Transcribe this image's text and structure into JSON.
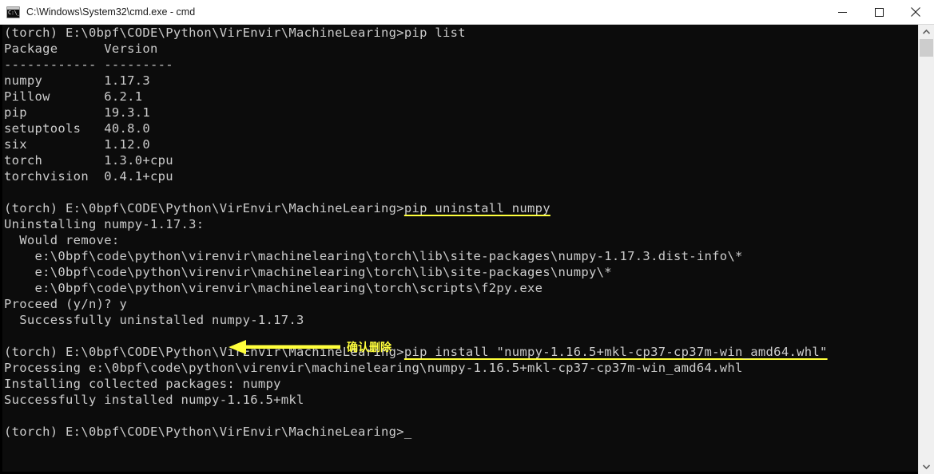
{
  "window": {
    "title": "C:\\Windows\\System32\\cmd.exe - cmd",
    "icon_label": "C:\\_",
    "minimize_label": "Minimize",
    "maximize_label": "Maximize",
    "close_label": "Close",
    "background_color": "#0c0c0c",
    "text_color": "#cccccc",
    "titlebar_color": "#ffffff"
  },
  "scrollbar": {
    "up_label": "Scroll up",
    "down_label": "Scroll down",
    "thumb_label": "Scroll thumb"
  },
  "annotation": {
    "label": "确认删除",
    "color": "#ffff3c",
    "arrow_direction": "left"
  },
  "console": {
    "prompt": "(torch) E:\\0bpf\\CODE\\Python\\VirEnvir\\MachineLearing>",
    "cursor": "_",
    "lines": [
      {
        "id": "l01",
        "text": "(torch) E:\\0bpf\\CODE\\Python\\VirEnvir\\MachineLearing>pip list"
      },
      {
        "id": "l02",
        "text": "Package      Version"
      },
      {
        "id": "l03",
        "text": "------------ ---------"
      },
      {
        "id": "l04",
        "text": "numpy        1.17.3"
      },
      {
        "id": "l05",
        "text": "Pillow       6.2.1"
      },
      {
        "id": "l06",
        "text": "pip          19.3.1"
      },
      {
        "id": "l07",
        "text": "setuptools   40.8.0"
      },
      {
        "id": "l08",
        "text": "six          1.12.0"
      },
      {
        "id": "l09",
        "text": "torch        1.3.0+cpu"
      },
      {
        "id": "l10",
        "text": "torchvision  0.4.1+cpu"
      },
      {
        "id": "l11",
        "text": ""
      },
      {
        "id": "l12",
        "text": "(torch) E:\\0bpf\\CODE\\Python\\VirEnvir\\MachineLearing>",
        "underlined": "pip uninstall numpy"
      },
      {
        "id": "l13",
        "text": "Uninstalling numpy-1.17.3:"
      },
      {
        "id": "l14",
        "text": "  Would remove:"
      },
      {
        "id": "l15",
        "text": "    e:\\0bpf\\code\\python\\virenvir\\machinelearing\\torch\\lib\\site-packages\\numpy-1.17.3.dist-info\\*"
      },
      {
        "id": "l16",
        "text": "    e:\\0bpf\\code\\python\\virenvir\\machinelearing\\torch\\lib\\site-packages\\numpy\\*"
      },
      {
        "id": "l17",
        "text": "    e:\\0bpf\\code\\python\\virenvir\\machinelearing\\torch\\scripts\\f2py.exe"
      },
      {
        "id": "l18",
        "text": "Proceed (y/n)? y"
      },
      {
        "id": "l19",
        "text": "  Successfully uninstalled numpy-1.17.3"
      },
      {
        "id": "l20",
        "text": ""
      },
      {
        "id": "l21",
        "text": "(torch) E:\\0bpf\\CODE\\Python\\VirEnvir\\MachineLearing>",
        "underlined": "pip install \"numpy-1.16.5+mkl-cp37-cp37m-win_amd64.whl\""
      },
      {
        "id": "l22",
        "text": "Processing e:\\0bpf\\code\\python\\virenvir\\machinelearing\\numpy-1.16.5+mkl-cp37-cp37m-win_amd64.whl"
      },
      {
        "id": "l23",
        "text": "Installing collected packages: numpy"
      },
      {
        "id": "l24",
        "text": "Successfully installed numpy-1.16.5+mkl"
      },
      {
        "id": "l25",
        "text": ""
      },
      {
        "id": "l26",
        "text": "(torch) E:\\0bpf\\CODE\\Python\\VirEnvir\\MachineLearing>",
        "cursor": true
      }
    ]
  }
}
